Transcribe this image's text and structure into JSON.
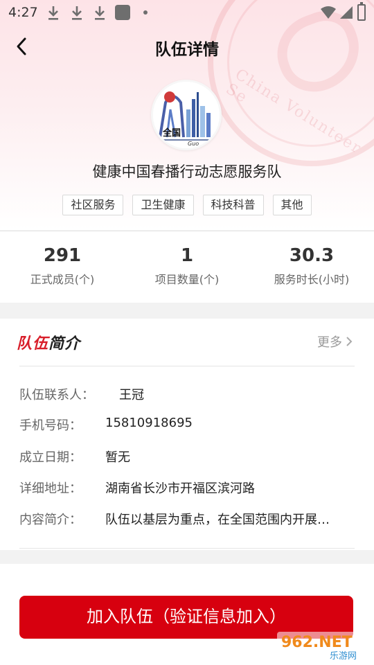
{
  "status_bar": {
    "time": "4:27"
  },
  "nav": {
    "title": "队伍详情"
  },
  "team": {
    "name": "健康中国春播行动志愿服务队",
    "avatar_text": "全国",
    "avatar_subtext": "Guo",
    "tags": [
      "社区服务",
      "卫生健康",
      "科技科普",
      "其他"
    ]
  },
  "background": {
    "seal_text": "China Volunteer Se"
  },
  "stats": [
    {
      "value": "291",
      "label": "正式成员(个)"
    },
    {
      "value": "1",
      "label": "项目数量(个)"
    },
    {
      "value": "30.3",
      "label": "服务时长(小时)"
    }
  ],
  "intro": {
    "title_red": "队伍",
    "title_black": "简介",
    "more": "更多",
    "rows": [
      {
        "label": "队伍联系人：",
        "value": "王冠"
      },
      {
        "label": "手机号码：",
        "value": "15810918695"
      },
      {
        "label": "成立日期：",
        "value": "暂无"
      },
      {
        "label": "详细地址：",
        "value": "湖南省长沙市开福区滨河路"
      },
      {
        "label": "内容简介：",
        "value": "队伍以基层为重点，在全国范围内开展…"
      }
    ]
  },
  "join_button": "加入队伍（验证信息加入）",
  "watermark": {
    "brand": "962.NET",
    "sub": "乐游网"
  },
  "colors": {
    "primary": "#d7000f",
    "title_red": "#d81e2a"
  }
}
